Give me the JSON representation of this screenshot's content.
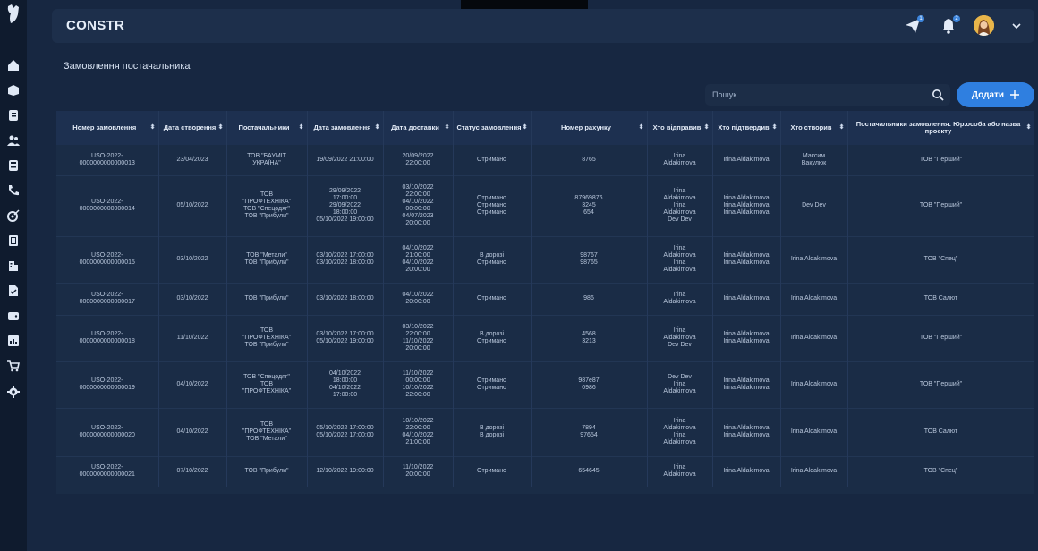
{
  "app": {
    "brand": "CONSTR"
  },
  "header": {
    "notifications_count": "2",
    "messages_count": "1"
  },
  "page": {
    "title": "Замовлення постачальника"
  },
  "search": {
    "placeholder": "Пошук"
  },
  "add_button": {
    "label": "Додати"
  },
  "table": {
    "columns": [
      "Номер замовлення",
      "Дата створення",
      "Постачальники",
      "Дата замовлення",
      "Дата доставки",
      "Статус замовлення",
      "Номер рахунку",
      "Хто відправив",
      "Хто підтвердив",
      "Хто створив",
      "Постачальники замовлення: Юр.особа або назва проекту"
    ],
    "rows": [
      {
        "order": [
          "USO-2022-",
          "0000000000000013"
        ],
        "created": [
          "23/04/2023"
        ],
        "suppliers": [
          "ТОВ \"БАУМІТ",
          "УКРАЇНА\""
        ],
        "order_date": [
          "19/09/2022 21:00:00"
        ],
        "delivery": [
          "20/09/2022",
          "22:00:00"
        ],
        "status": [
          "Отримано"
        ],
        "invoice": [
          "8765"
        ],
        "sent_by": [
          "Irina",
          "Aldakimova"
        ],
        "confirmed_by": [
          "Irina Aldakimova"
        ],
        "created_by": [
          "Максим",
          "Вакулюк"
        ],
        "entity": [
          "ТОВ \"Перший\""
        ]
      },
      {
        "order": [
          "USO-2022-",
          "0000000000000014"
        ],
        "created": [
          "05/10/2022"
        ],
        "suppliers": [
          "ТОВ",
          "\"ПРОФТЕХНІКА\"",
          "ТОВ \"Спецодяг\"",
          "ТОВ \"Прибули\""
        ],
        "order_date": [
          "29/09/2022",
          "17:00:00",
          "29/09/2022",
          "18:00:00",
          "05/10/2022 19:00:00"
        ],
        "delivery": [
          "03/10/2022",
          "22:00:00",
          "04/10/2022",
          "00:00:00",
          "04/07/2023",
          "20:00:00"
        ],
        "status": [
          "Отримано",
          "Отримано",
          "Отримано"
        ],
        "invoice": [
          "87969876",
          "3245",
          "654"
        ],
        "sent_by": [
          "Irina",
          "Aldakimova",
          "Irina",
          "Aldakimova",
          "Dev Dev"
        ],
        "confirmed_by": [
          "Irina Aldakimova",
          "Irina Aldakimova",
          "Irina Aldakimova"
        ],
        "created_by": [
          "Dev Dev"
        ],
        "entity": [
          "ТОВ \"Перший\""
        ]
      },
      {
        "order": [
          "USO-2022-",
          "0000000000000015"
        ],
        "created": [
          "03/10/2022"
        ],
        "suppliers": [
          "ТОВ \"Метали\"",
          "ТОВ \"Прибули\""
        ],
        "order_date": [
          "03/10/2022 17:00:00",
          "03/10/2022 18:00:00"
        ],
        "delivery": [
          "04/10/2022",
          "21:00:00",
          "04/10/2022",
          "20:00:00"
        ],
        "status": [
          "В дорозі",
          "Отримано"
        ],
        "invoice": [
          "98767",
          "98765"
        ],
        "sent_by": [
          "Irina",
          "Aldakimova",
          "Irina",
          "Aldakimova"
        ],
        "confirmed_by": [
          "Irina Aldakimova",
          "Irina Aldakimova"
        ],
        "created_by": [
          "Irina Aldakimova"
        ],
        "entity": [
          "ТОВ \"Спец\""
        ]
      },
      {
        "order": [
          "USO-2022-",
          "0000000000000017"
        ],
        "created": [
          "03/10/2022"
        ],
        "suppliers": [
          "ТОВ \"Прибули\""
        ],
        "order_date": [
          "03/10/2022 18:00:00"
        ],
        "delivery": [
          "04/10/2022",
          "20:00:00"
        ],
        "status": [
          "Отримано"
        ],
        "invoice": [
          "986"
        ],
        "sent_by": [
          "Irina",
          "Aldakimova"
        ],
        "confirmed_by": [
          "Irina Aldakimova"
        ],
        "created_by": [
          "Irina Aldakimova"
        ],
        "entity": [
          "ТОВ Салют"
        ]
      },
      {
        "order": [
          "USO-2022-",
          "0000000000000018"
        ],
        "created": [
          "11/10/2022"
        ],
        "suppliers": [
          "ТОВ",
          "\"ПРОФТЕХНІКА\"",
          "ТОВ \"Прибули\""
        ],
        "order_date": [
          "03/10/2022 17:00:00",
          "05/10/2022 19:00:00"
        ],
        "delivery": [
          "03/10/2022",
          "22:00:00",
          "11/10/2022",
          "20:00:00"
        ],
        "status": [
          "В дорозі",
          "Отримано"
        ],
        "invoice": [
          "4568",
          "3213"
        ],
        "sent_by": [
          "Irina",
          "Aldakimova",
          "Dev Dev"
        ],
        "confirmed_by": [
          "Irina Aldakimova",
          "Irina Aldakimova"
        ],
        "created_by": [
          "Irina Aldakimova"
        ],
        "entity": [
          "ТОВ \"Перший\""
        ]
      },
      {
        "order": [
          "USO-2022-",
          "0000000000000019"
        ],
        "created": [
          "04/10/2022"
        ],
        "suppliers": [
          "ТОВ \"Спецодяг\"",
          "ТОВ",
          "\"ПРОФТЕХНІКА\""
        ],
        "order_date": [
          "04/10/2022",
          "18:00:00",
          "04/10/2022",
          "17:00:00"
        ],
        "delivery": [
          "11/10/2022",
          "00:00:00",
          "10/10/2022",
          "22:00:00"
        ],
        "status": [
          "Отримано",
          "Отримано"
        ],
        "invoice": [
          "987e87",
          "0986"
        ],
        "sent_by": [
          "Dev Dev",
          "Irina",
          "Aldakimova"
        ],
        "confirmed_by": [
          "Irina Aldakimova",
          "Irina Aldakimova"
        ],
        "created_by": [
          "Irina Aldakimova"
        ],
        "entity": [
          "ТОВ \"Перший\""
        ]
      },
      {
        "order": [
          "USO-2022-",
          "0000000000000020"
        ],
        "created": [
          "04/10/2022"
        ],
        "suppliers": [
          "ТОВ",
          "\"ПРОФТЕХНІКА\"",
          "ТОВ \"Метали\""
        ],
        "order_date": [
          "05/10/2022 17:00:00",
          "05/10/2022 17:00:00"
        ],
        "delivery": [
          "10/10/2022",
          "22:00:00",
          "04/10/2022",
          "21:00:00"
        ],
        "status": [
          "В дорозі",
          "В дорозі"
        ],
        "invoice": [
          "7894",
          "97654"
        ],
        "sent_by": [
          "Irina",
          "Aldakimova",
          "Irina",
          "Aldakimova"
        ],
        "confirmed_by": [
          "Irina Aldakimova",
          "Irina Aldakimova"
        ],
        "created_by": [
          "Irina Aldakimova"
        ],
        "entity": [
          "ТОВ Салют"
        ]
      },
      {
        "order": [
          "USO-2022-",
          "0000000000000021"
        ],
        "created": [
          "07/10/2022"
        ],
        "suppliers": [
          "ТОВ \"Прибули\""
        ],
        "order_date": [
          "12/10/2022 19:00:00"
        ],
        "delivery": [
          "11/10/2022",
          "20:00:00"
        ],
        "status": [
          "Отримано"
        ],
        "invoice": [
          "654645"
        ],
        "sent_by": [
          "Irina",
          "Aldakimova"
        ],
        "confirmed_by": [
          "Irina Aldakimova"
        ],
        "created_by": [
          "Irina Aldakimova"
        ],
        "entity": [
          "ТОВ \"Спец\""
        ]
      }
    ]
  }
}
